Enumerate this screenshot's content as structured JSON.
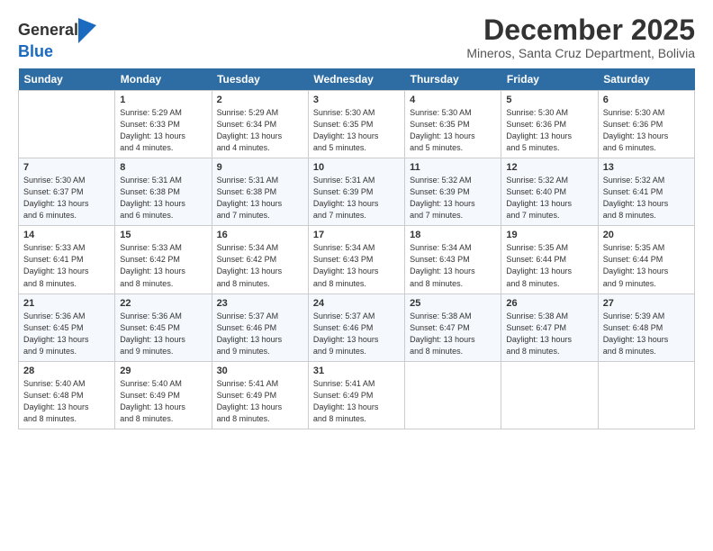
{
  "header": {
    "logo_line1": "General",
    "logo_line2": "Blue",
    "title": "December 2025",
    "subtitle": "Mineros, Santa Cruz Department, Bolivia"
  },
  "days_of_week": [
    "Sunday",
    "Monday",
    "Tuesday",
    "Wednesday",
    "Thursday",
    "Friday",
    "Saturday"
  ],
  "weeks": [
    [
      {
        "day": "",
        "info": ""
      },
      {
        "day": "1",
        "info": "Sunrise: 5:29 AM\nSunset: 6:33 PM\nDaylight: 13 hours\nand 4 minutes."
      },
      {
        "day": "2",
        "info": "Sunrise: 5:29 AM\nSunset: 6:34 PM\nDaylight: 13 hours\nand 4 minutes."
      },
      {
        "day": "3",
        "info": "Sunrise: 5:30 AM\nSunset: 6:35 PM\nDaylight: 13 hours\nand 5 minutes."
      },
      {
        "day": "4",
        "info": "Sunrise: 5:30 AM\nSunset: 6:35 PM\nDaylight: 13 hours\nand 5 minutes."
      },
      {
        "day": "5",
        "info": "Sunrise: 5:30 AM\nSunset: 6:36 PM\nDaylight: 13 hours\nand 5 minutes."
      },
      {
        "day": "6",
        "info": "Sunrise: 5:30 AM\nSunset: 6:36 PM\nDaylight: 13 hours\nand 6 minutes."
      }
    ],
    [
      {
        "day": "7",
        "info": "Sunrise: 5:30 AM\nSunset: 6:37 PM\nDaylight: 13 hours\nand 6 minutes."
      },
      {
        "day": "8",
        "info": "Sunrise: 5:31 AM\nSunset: 6:38 PM\nDaylight: 13 hours\nand 6 minutes."
      },
      {
        "day": "9",
        "info": "Sunrise: 5:31 AM\nSunset: 6:38 PM\nDaylight: 13 hours\nand 7 minutes."
      },
      {
        "day": "10",
        "info": "Sunrise: 5:31 AM\nSunset: 6:39 PM\nDaylight: 13 hours\nand 7 minutes."
      },
      {
        "day": "11",
        "info": "Sunrise: 5:32 AM\nSunset: 6:39 PM\nDaylight: 13 hours\nand 7 minutes."
      },
      {
        "day": "12",
        "info": "Sunrise: 5:32 AM\nSunset: 6:40 PM\nDaylight: 13 hours\nand 7 minutes."
      },
      {
        "day": "13",
        "info": "Sunrise: 5:32 AM\nSunset: 6:41 PM\nDaylight: 13 hours\nand 8 minutes."
      }
    ],
    [
      {
        "day": "14",
        "info": "Sunrise: 5:33 AM\nSunset: 6:41 PM\nDaylight: 13 hours\nand 8 minutes."
      },
      {
        "day": "15",
        "info": "Sunrise: 5:33 AM\nSunset: 6:42 PM\nDaylight: 13 hours\nand 8 minutes."
      },
      {
        "day": "16",
        "info": "Sunrise: 5:34 AM\nSunset: 6:42 PM\nDaylight: 13 hours\nand 8 minutes."
      },
      {
        "day": "17",
        "info": "Sunrise: 5:34 AM\nSunset: 6:43 PM\nDaylight: 13 hours\nand 8 minutes."
      },
      {
        "day": "18",
        "info": "Sunrise: 5:34 AM\nSunset: 6:43 PM\nDaylight: 13 hours\nand 8 minutes."
      },
      {
        "day": "19",
        "info": "Sunrise: 5:35 AM\nSunset: 6:44 PM\nDaylight: 13 hours\nand 8 minutes."
      },
      {
        "day": "20",
        "info": "Sunrise: 5:35 AM\nSunset: 6:44 PM\nDaylight: 13 hours\nand 9 minutes."
      }
    ],
    [
      {
        "day": "21",
        "info": "Sunrise: 5:36 AM\nSunset: 6:45 PM\nDaylight: 13 hours\nand 9 minutes."
      },
      {
        "day": "22",
        "info": "Sunrise: 5:36 AM\nSunset: 6:45 PM\nDaylight: 13 hours\nand 9 minutes."
      },
      {
        "day": "23",
        "info": "Sunrise: 5:37 AM\nSunset: 6:46 PM\nDaylight: 13 hours\nand 9 minutes."
      },
      {
        "day": "24",
        "info": "Sunrise: 5:37 AM\nSunset: 6:46 PM\nDaylight: 13 hours\nand 9 minutes."
      },
      {
        "day": "25",
        "info": "Sunrise: 5:38 AM\nSunset: 6:47 PM\nDaylight: 13 hours\nand 8 minutes."
      },
      {
        "day": "26",
        "info": "Sunrise: 5:38 AM\nSunset: 6:47 PM\nDaylight: 13 hours\nand 8 minutes."
      },
      {
        "day": "27",
        "info": "Sunrise: 5:39 AM\nSunset: 6:48 PM\nDaylight: 13 hours\nand 8 minutes."
      }
    ],
    [
      {
        "day": "28",
        "info": "Sunrise: 5:40 AM\nSunset: 6:48 PM\nDaylight: 13 hours\nand 8 minutes."
      },
      {
        "day": "29",
        "info": "Sunrise: 5:40 AM\nSunset: 6:49 PM\nDaylight: 13 hours\nand 8 minutes."
      },
      {
        "day": "30",
        "info": "Sunrise: 5:41 AM\nSunset: 6:49 PM\nDaylight: 13 hours\nand 8 minutes."
      },
      {
        "day": "31",
        "info": "Sunrise: 5:41 AM\nSunset: 6:49 PM\nDaylight: 13 hours\nand 8 minutes."
      },
      {
        "day": "",
        "info": ""
      },
      {
        "day": "",
        "info": ""
      },
      {
        "day": "",
        "info": ""
      }
    ]
  ]
}
